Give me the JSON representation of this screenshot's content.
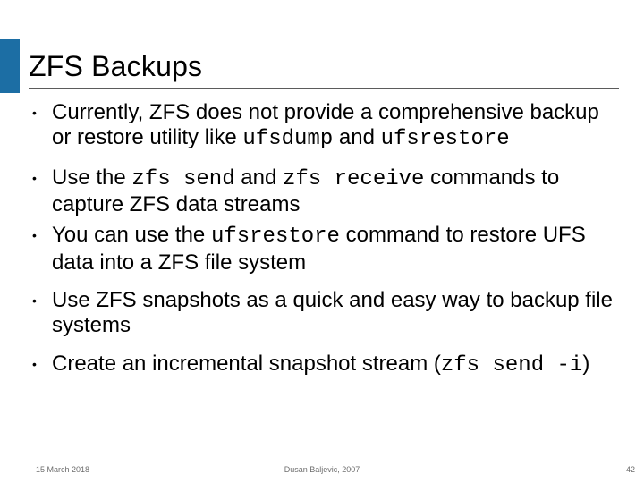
{
  "slide": {
    "title": "ZFS Backups",
    "bullets": [
      {
        "parts": [
          {
            "t": "Currently, ZFS does not provide a comprehensive backup or restore utility like "
          },
          {
            "t": "ufsdump",
            "mono": true
          },
          {
            "t": " and "
          },
          {
            "t": "ufsrestore",
            "mono": true
          }
        ]
      },
      {
        "tight": true,
        "parts": [
          {
            "t": "Use the "
          },
          {
            "t": "zfs send",
            "mono": true
          },
          {
            "t": " and "
          },
          {
            "t": "zfs receive",
            "mono": true
          },
          {
            "t": " commands to capture ZFS data streams"
          }
        ]
      },
      {
        "parts": [
          {
            "t": "You can use the "
          },
          {
            "t": "ufsrestore",
            "mono": true
          },
          {
            "t": " command to restore UFS data into a ZFS file system"
          }
        ]
      },
      {
        "parts": [
          {
            "t": "Use ZFS snapshots as a quick and easy way to backup file systems"
          }
        ]
      },
      {
        "parts": [
          {
            "t": "Create an incremental snapshot stream ("
          },
          {
            "t": "zfs send -i",
            "mono": true
          },
          {
            "t": ")"
          }
        ]
      }
    ]
  },
  "footer": {
    "date": "15 March 2018",
    "author": "Dusan Baljevic, 2007",
    "page": "42"
  }
}
